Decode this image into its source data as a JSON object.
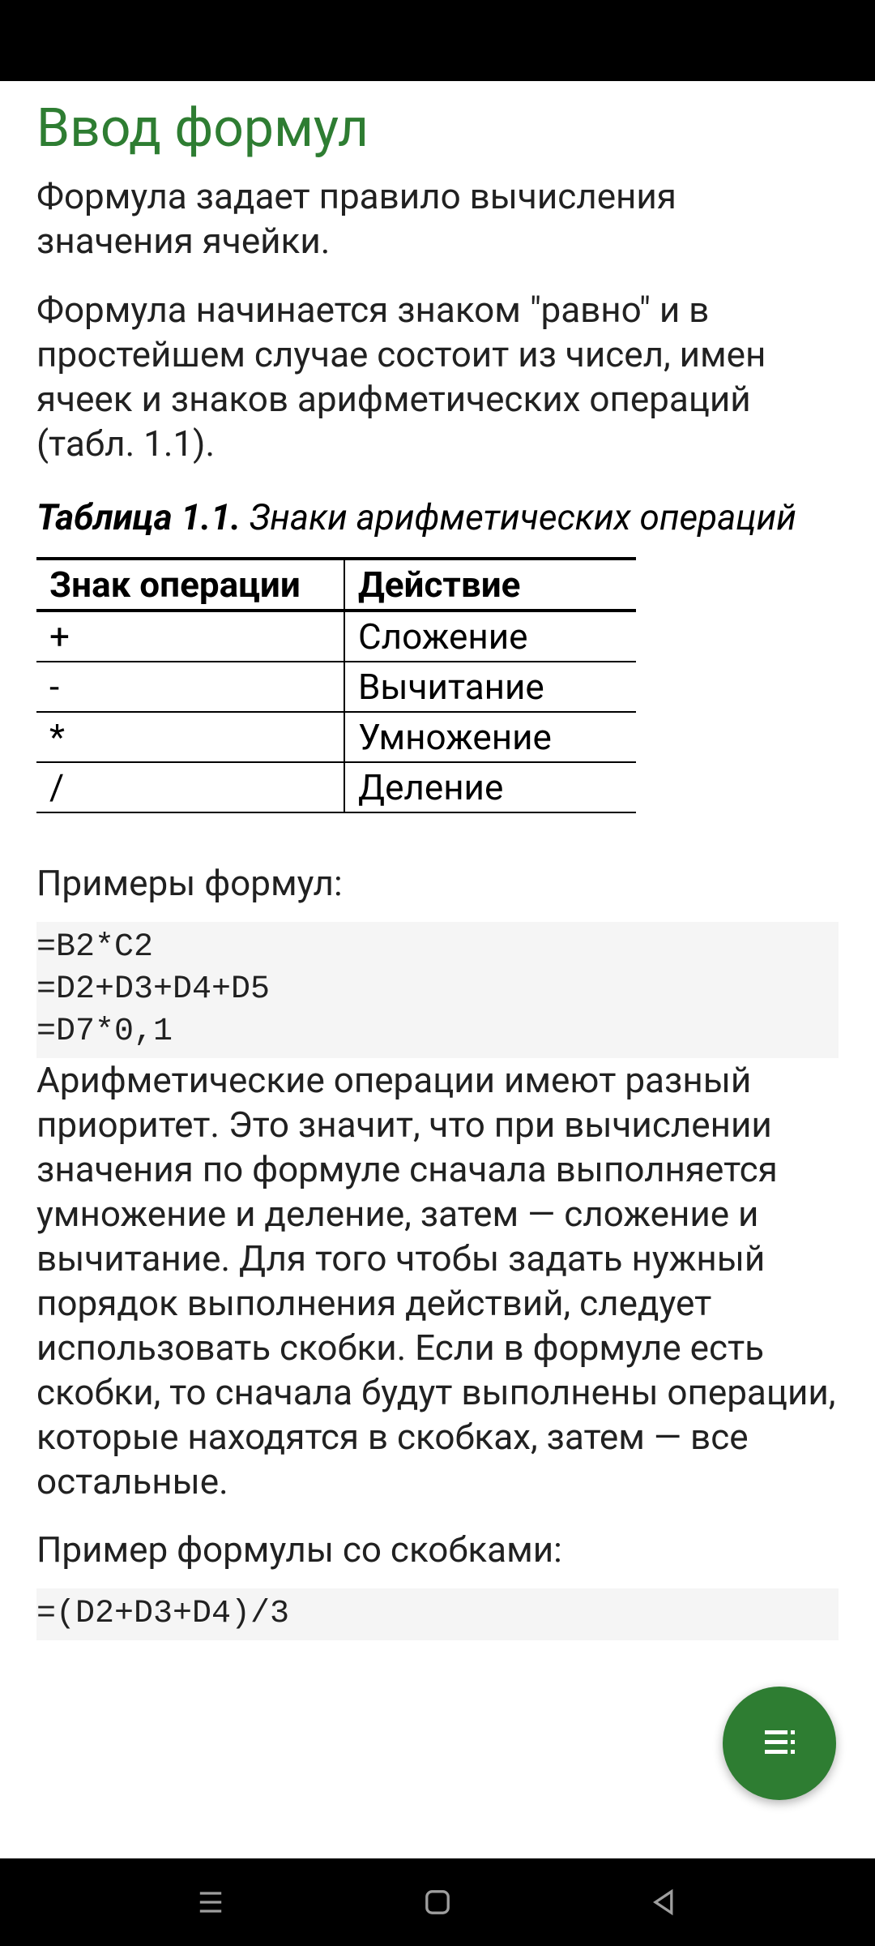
{
  "heading": "Ввод формул",
  "paragraph1": "Формула задает правило вычисления значения ячейки.",
  "paragraph2": "Формула начинается знаком \"равно\" и в простейшем случае состоит из чисел, имен ячеек и знаков арифметических операций (табл. 1.1).",
  "table_caption_bold": "Таблица 1.1.",
  "table_caption_italic": " Знаки арифметических операций",
  "table": {
    "headers": [
      "Знак операции",
      "Действие"
    ],
    "rows": [
      [
        "+",
        "Сложение"
      ],
      [
        "-",
        "Вычитание"
      ],
      [
        "*",
        "Умножение"
      ],
      [
        "/",
        "Деление"
      ]
    ]
  },
  "examples_label": "Примеры формул:",
  "code1": "=B2*C2\n=D2+D3+D4+D5\n=D7*0,1",
  "paragraph3": "Арифметические операции имеют разный приоритет. Это значит, что при вычислении значения по формуле сначала выполняется умножение и деление, затем — сложение и вычитание. Для того чтобы задать нужный порядок выполнения действий, следует использовать скобки. Если в формуле есть скобки, то сначала будут выполнены операции, которые находятся в скобках, затем — все остальные.",
  "example2_label": "Пример формулы со скобками:",
  "code2": "=(D2+D3+D4)/3"
}
